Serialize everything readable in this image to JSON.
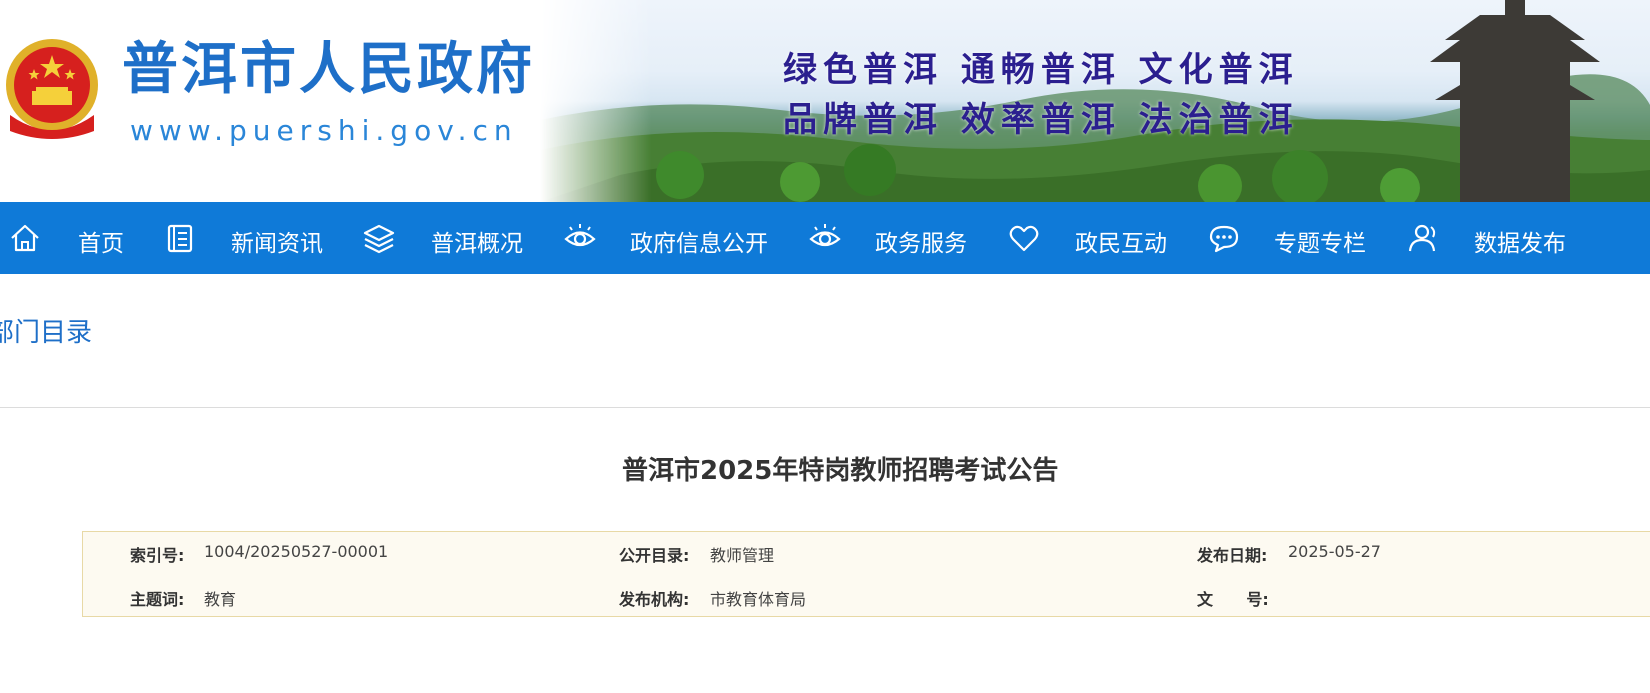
{
  "header": {
    "site_title": "普洱市人民政府",
    "site_url": "www.puershi.gov.cn",
    "slogan_line1": "绿色普洱  通畅普洱  文化普洱",
    "slogan_line2": "品牌普洱  效率普洱  法治普洱"
  },
  "nav": {
    "items": [
      {
        "label": "首页",
        "icon": "home-icon"
      },
      {
        "label": "新闻资讯",
        "icon": "document-icon"
      },
      {
        "label": "普洱概况",
        "icon": "layers-icon"
      },
      {
        "label": "政府信息公开",
        "icon": "eye-icon"
      },
      {
        "label": "政务服务",
        "icon": "eye-icon"
      },
      {
        "label": "政民互动",
        "icon": "heart-icon"
      },
      {
        "label": "专题专栏",
        "icon": "chat-icon"
      },
      {
        "label": "数据发布",
        "icon": "user-icon"
      }
    ]
  },
  "breadcrumb": {
    "text": "部门目录"
  },
  "article": {
    "title": "普洱市2025年特岗教师招聘考试公告",
    "meta": {
      "index_label": "索引号:",
      "index_value": "1004/20250527-00001",
      "catalog_label": "公开目录:",
      "catalog_value": "教师管理",
      "date_label": "发布日期:",
      "date_value": "2025-05-27",
      "topic_label": "主题词:",
      "topic_value": "教育",
      "org_label": "发布机构:",
      "org_value": "市教育体育局",
      "docno_label": "文      号:",
      "docno_value": ""
    }
  },
  "colors": {
    "nav_bg": "#0f7ad8",
    "title_blue": "#1e6fc8",
    "slogan": "#2b1f8f",
    "meta_bg": "#fdfaf1",
    "meta_border": "#e8d9a6"
  }
}
